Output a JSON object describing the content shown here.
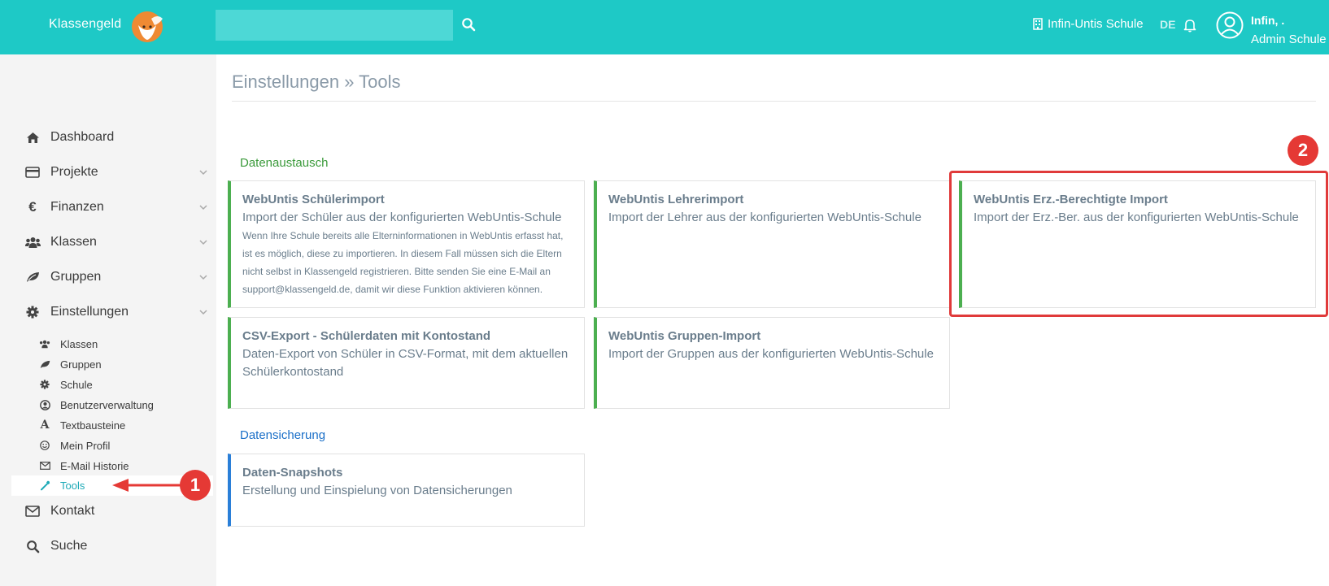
{
  "header": {
    "brand": "Klassengeld",
    "search_placeholder": "",
    "school_name": "Infin-Untis Schule",
    "language": "DE",
    "user_name": "Infin, .",
    "user_role": "Admin Schule"
  },
  "sidebar": {
    "items": [
      {
        "label": "Dashboard",
        "icon": "home-icon"
      },
      {
        "label": "Projekte",
        "icon": "credit-card-icon"
      },
      {
        "label": "Finanzen",
        "icon": "euro-icon"
      },
      {
        "label": "Klassen",
        "icon": "users-icon"
      },
      {
        "label": "Gruppen",
        "icon": "leaf-icon"
      },
      {
        "label": "Einstellungen",
        "icon": "gear-icon"
      },
      {
        "label": "Kontakt",
        "icon": "envelope-icon"
      },
      {
        "label": "Suche",
        "icon": "search-icon"
      }
    ],
    "sub_items": [
      {
        "label": "Klassen",
        "icon": "users-icon"
      },
      {
        "label": "Gruppen",
        "icon": "leaf-icon"
      },
      {
        "label": "Schule",
        "icon": "gear-icon"
      },
      {
        "label": "Benutzerverwaltung",
        "icon": "user-circle-icon"
      },
      {
        "label": "Textbausteine",
        "icon": "font-icon"
      },
      {
        "label": "Mein Profil",
        "icon": "smile-icon"
      },
      {
        "label": "E-Mail Historie",
        "icon": "envelope-icon"
      },
      {
        "label": "Tools",
        "icon": "wrench-icon"
      }
    ]
  },
  "main": {
    "title": "Einstellungen » Tools",
    "sections": [
      {
        "label": "Datenaustausch",
        "color": "#3a9a3a",
        "cards": [
          {
            "title": "WebUntis Schülerimport",
            "description": "Import der Schüler aus der konfigurierten WebUntis-Schule",
            "note": "Wenn Ihre Schule bereits alle Elterninformationen in WebUntis erfasst hat, ist es möglich, diese zu importieren. In diesem Fall müssen sich die Eltern nicht selbst in Klassengeld registrieren. Bitte senden Sie eine E-Mail an support@klassengeld.de, damit wir diese Funktion aktivieren können."
          },
          {
            "title": "WebUntis Lehrerimport",
            "description": "Import der Lehrer aus der konfigurierten WebUntis-Schule"
          },
          {
            "title": "WebUntis Erz.-Berechtigte Import",
            "description": "Import der Erz.-Ber. aus der konfigurierten WebUntis-Schule"
          },
          {
            "title": "CSV-Export - Schülerdaten mit Kontostand",
            "description": "Daten-Export von Schüler in CSV-Format, mit dem aktuellen Schülerkontostand"
          },
          {
            "title": "WebUntis Gruppen-Import",
            "description": "Import der Gruppen aus der konfigurierten WebUntis-Schule"
          }
        ]
      },
      {
        "label": "Datensicherung",
        "color": "#1a6fc8",
        "cards": [
          {
            "title": "Daten-Snapshots",
            "description": "Erstellung und Einspielung von Datensicherungen"
          }
        ]
      }
    ]
  },
  "annotations": {
    "badge_1": "1",
    "badge_2": "2",
    "color": "#e53935"
  }
}
